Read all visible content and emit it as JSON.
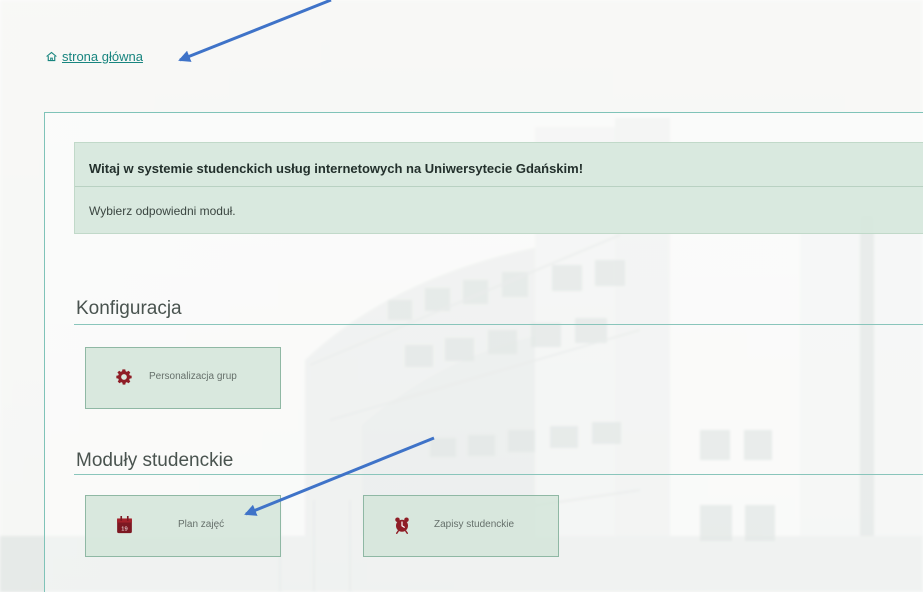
{
  "breadcrumb": {
    "home_label": "strona główna",
    "home_icon": "home-icon"
  },
  "welcome": {
    "title": "Witaj w systemie studenckich usług internetowych na Uniwersytecie Gdańskim!",
    "subtitle": "Wybierz odpowiedni moduł."
  },
  "sections": {
    "configuration": {
      "title": "Konfiguracja",
      "modules": [
        {
          "label": "Personalizacja grup",
          "icon": "gear-icon"
        }
      ]
    },
    "student_modules": {
      "title": "Moduły studenckie",
      "modules": [
        {
          "label": "Plan zajęć",
          "icon": "calendar-icon",
          "icon_text": "19"
        },
        {
          "label": "Zapisy studenckie",
          "icon": "alarm-clock-icon"
        }
      ]
    }
  },
  "colors": {
    "accent_teal": "#18857f",
    "tile_green": "#d6e6db",
    "icon_maroon": "#8f1d26",
    "arrow_blue": "#3f73c8"
  }
}
